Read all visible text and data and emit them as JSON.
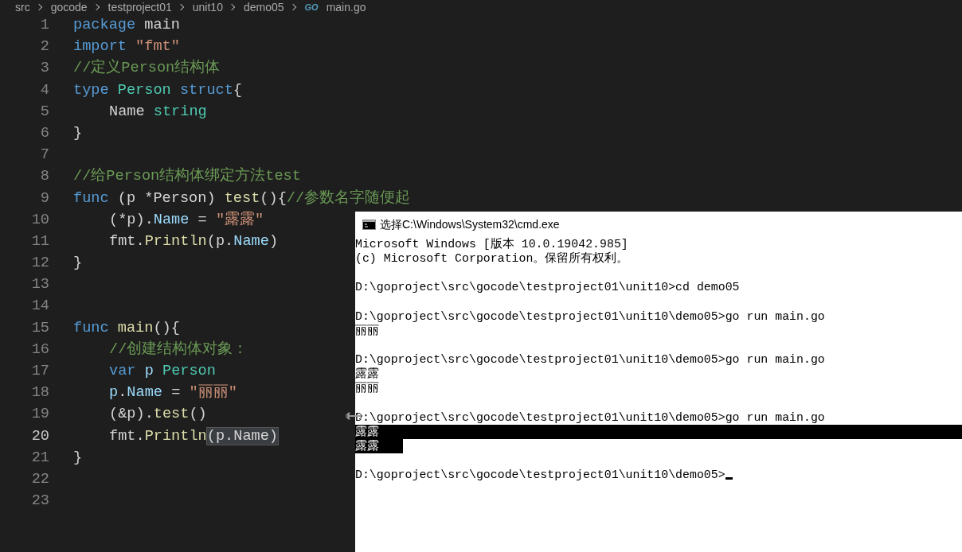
{
  "breadcrumb": {
    "items": [
      {
        "label": "src"
      },
      {
        "label": "gocode"
      },
      {
        "label": "testproject01"
      },
      {
        "label": "unit10"
      },
      {
        "label": "demo05"
      },
      {
        "label": "main.go",
        "icon_text": "GO"
      }
    ]
  },
  "editor": {
    "lines": [
      {
        "number": "1",
        "current": false,
        "tokens": [
          {
            "kind": "keyword",
            "text": "package"
          },
          {
            "kind": "plain",
            "text": " main"
          }
        ]
      },
      {
        "number": "2",
        "current": false,
        "tokens": [
          {
            "kind": "keyword",
            "text": "import "
          },
          {
            "kind": "string",
            "text": "\"fmt\""
          }
        ]
      },
      {
        "number": "3",
        "current": false,
        "tokens": [
          {
            "kind": "comment",
            "text": "//定义Person结构体"
          }
        ]
      },
      {
        "number": "4",
        "current": false,
        "tokens": [
          {
            "kind": "keyword",
            "text": "type "
          },
          {
            "kind": "type",
            "text": "Person "
          },
          {
            "kind": "keyword",
            "text": "struct"
          },
          {
            "kind": "plain",
            "text": "{"
          }
        ],
        "children": [
          {
            "number": "5",
            "current": false,
            "tokens": [
              {
                "kind": "plain",
                "text": "Name "
              },
              {
                "kind": "type",
                "text": "string"
              }
            ]
          }
        ]
      },
      {
        "number": "6",
        "current": false,
        "tokens": [
          {
            "kind": "plain",
            "text": "}"
          }
        ]
      },
      {
        "number": "7",
        "current": false
      },
      {
        "number": "8",
        "current": false,
        "tokens": [
          {
            "kind": "comment",
            "text": "//给Person结构体绑定方法test"
          }
        ]
      },
      {
        "number": "9",
        "current": false,
        "tokens": [
          {
            "kind": "keyword",
            "text": "func"
          },
          {
            "kind": "plain",
            "text": " (p *Person) "
          },
          {
            "kind": "func",
            "text": "test"
          },
          {
            "kind": "plain",
            "text": "(){"
          },
          {
            "kind": "comment",
            "text": "//参数名字随便起"
          }
        ],
        "children": [
          {
            "number": "10",
            "current": false,
            "tokens": [
              {
                "kind": "plain",
                "text": "(*p)."
              },
              {
                "kind": "variable",
                "text": "Name"
              },
              {
                "kind": "plain",
                "text": " = "
              },
              {
                "kind": "string",
                "text": "\"露露\""
              }
            ]
          },
          {
            "number": "11",
            "current": false,
            "tokens": [
              {
                "kind": "plain",
                "text": "fmt."
              },
              {
                "kind": "func",
                "text": "Println"
              },
              {
                "kind": "plain",
                "text": "(p."
              },
              {
                "kind": "variable",
                "text": "Name"
              },
              {
                "kind": "plain",
                "text": ")"
              }
            ]
          }
        ]
      },
      {
        "number": "12",
        "current": false,
        "tokens": [
          {
            "kind": "plain",
            "text": "}"
          }
        ]
      },
      {
        "number": "13",
        "current": false
      },
      {
        "number": "14",
        "current": false
      },
      {
        "number": "15",
        "current": false,
        "tokens": [
          {
            "kind": "keyword",
            "text": "func "
          },
          {
            "kind": "func",
            "text": "main"
          },
          {
            "kind": "plain",
            "text": "(){"
          }
        ],
        "children": [
          {
            "number": "16",
            "current": false,
            "tokens": [
              {
                "kind": "comment",
                "text": "//创建结构体对象："
              }
            ]
          },
          {
            "number": "17",
            "current": false,
            "tokens": [
              {
                "kind": "keyword",
                "text": "var "
              },
              {
                "kind": "variable",
                "text": "p "
              },
              {
                "kind": "type",
                "text": "Person"
              }
            ]
          },
          {
            "number": "18",
            "current": false,
            "tokens": [
              {
                "kind": "variable",
                "text": "p"
              },
              {
                "kind": "plain",
                "text": "."
              },
              {
                "kind": "variable",
                "text": "Name"
              },
              {
                "kind": "plain",
                "text": " = "
              },
              {
                "kind": "string",
                "text": "\"丽丽\""
              }
            ]
          },
          {
            "number": "19",
            "current": false,
            "tokens": [
              {
                "kind": "plain",
                "text": "(&p)."
              },
              {
                "kind": "func",
                "text": "test"
              },
              {
                "kind": "plain",
                "text": "()"
              }
            ]
          },
          {
            "number": "20",
            "current": true,
            "tokens": [
              {
                "kind": "plain",
                "text": "fmt."
              },
              {
                "kind": "func",
                "text": "Println"
              },
              {
                "kind": "match",
                "text": "(p.Name)"
              }
            ]
          }
        ]
      },
      {
        "number": "21",
        "current": false,
        "tokens": [
          {
            "kind": "plain",
            "text": "}"
          }
        ]
      },
      {
        "number": "22",
        "current": false
      },
      {
        "number": "23",
        "current": false
      }
    ]
  },
  "console": {
    "title": "选择C:\\Windows\\System32\\cmd.exe",
    "blocks": [
      {
        "lines": [
          {
            "text": "Microsoft Windows [版本 10.0.19042.985]",
            "selected": false
          },
          {
            "text": "(c) Microsoft Corporation。保留所有权利。",
            "selected": false
          }
        ]
      },
      {
        "lines": [
          {
            "text": "D:\\goproject\\src\\gocode\\testproject01\\unit10>cd demo05",
            "selected": false
          }
        ]
      },
      {
        "lines": [
          {
            "text": "D:\\goproject\\src\\gocode\\testproject01\\unit10\\demo05>go run main.go",
            "selected": false
          },
          {
            "text": "丽丽",
            "selected": false
          }
        ]
      },
      {
        "lines": [
          {
            "text": "D:\\goproject\\src\\gocode\\testproject01\\unit10\\demo05>go run main.go",
            "selected": false
          },
          {
            "text": "露露",
            "selected": false
          },
          {
            "text": "丽丽",
            "selected": false
          }
        ]
      },
      {
        "lines": [
          {
            "text": "D:\\goproject\\src\\gocode\\testproject01\\unit10\\demo05>go run main.go",
            "selected": false
          },
          {
            "text": "露露",
            "selected": true
          },
          {
            "text": "露露",
            "selected": true
          }
        ]
      },
      {
        "lines": [
          {
            "text": "D:\\goproject\\src\\gocode\\testproject01\\unit10\\demo05>",
            "selected": false,
            "cursor": true
          }
        ]
      }
    ]
  }
}
